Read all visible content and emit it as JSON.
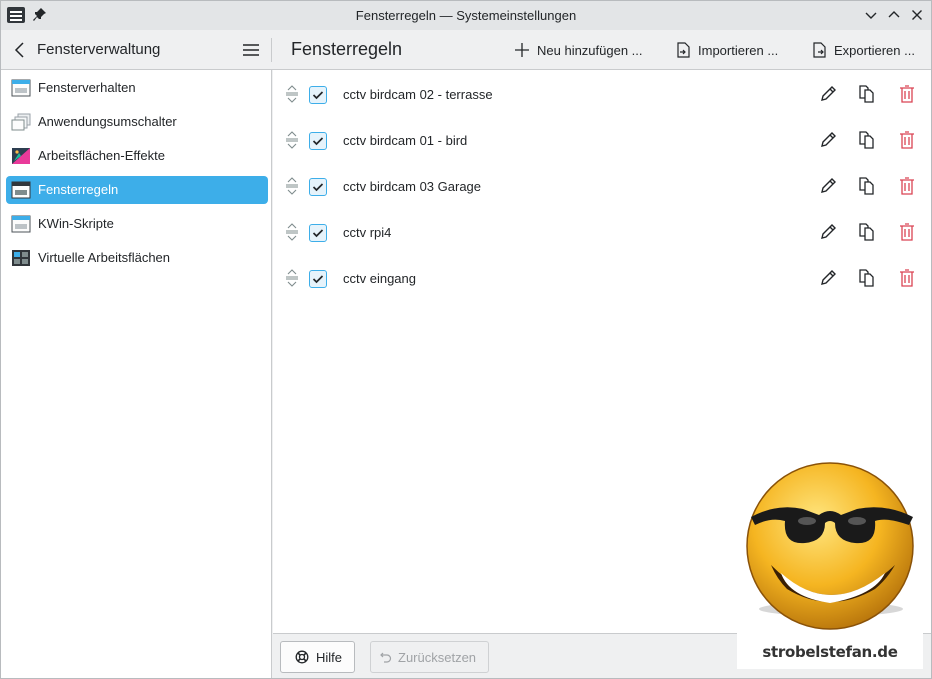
{
  "window": {
    "title": "Fensterregeln — Systemeinstellungen",
    "controls": [
      "minimize-icon",
      "maximize-icon",
      "close-icon"
    ]
  },
  "sidebar": {
    "title": "Fensterverwaltung",
    "items": [
      {
        "label": "Fensterverhalten",
        "icon": "window-behavior-icon",
        "active": false
      },
      {
        "label": "Anwendungsumschalter",
        "icon": "task-switcher-icon",
        "active": false
      },
      {
        "label": "Arbeitsflächen-Effekte",
        "icon": "desktop-effects-icon",
        "active": false
      },
      {
        "label": "Fensterregeln",
        "icon": "window-rules-icon",
        "active": true
      },
      {
        "label": "KWin-Skripte",
        "icon": "kwin-scripts-icon",
        "active": false
      },
      {
        "label": "Virtuelle Arbeitsflächen",
        "icon": "virtual-desktops-icon",
        "active": false
      }
    ]
  },
  "main": {
    "title": "Fensterregeln",
    "actions": {
      "add": "Neu hinzufügen ...",
      "import": "Importieren ...",
      "export": "Exportieren ..."
    },
    "rules": [
      {
        "name": "cctv birdcam 02 - terrasse",
        "enabled": true
      },
      {
        "name": "cctv birdcam 01 - bird",
        "enabled": true
      },
      {
        "name": "cctv birdcam 03 Garage",
        "enabled": true
      },
      {
        "name": "cctv rpi4",
        "enabled": true
      },
      {
        "name": "cctv eingang",
        "enabled": true
      }
    ],
    "row_actions": [
      "edit-icon",
      "duplicate-icon",
      "delete-icon"
    ]
  },
  "footer": {
    "help": "Hilfe",
    "reset": "Zurücksetzen"
  },
  "watermark": {
    "text": "strobelstefan.de"
  },
  "colors": {
    "accent": "#3daee9",
    "delete": "#da4453",
    "window_bg": "#eff0f1"
  }
}
